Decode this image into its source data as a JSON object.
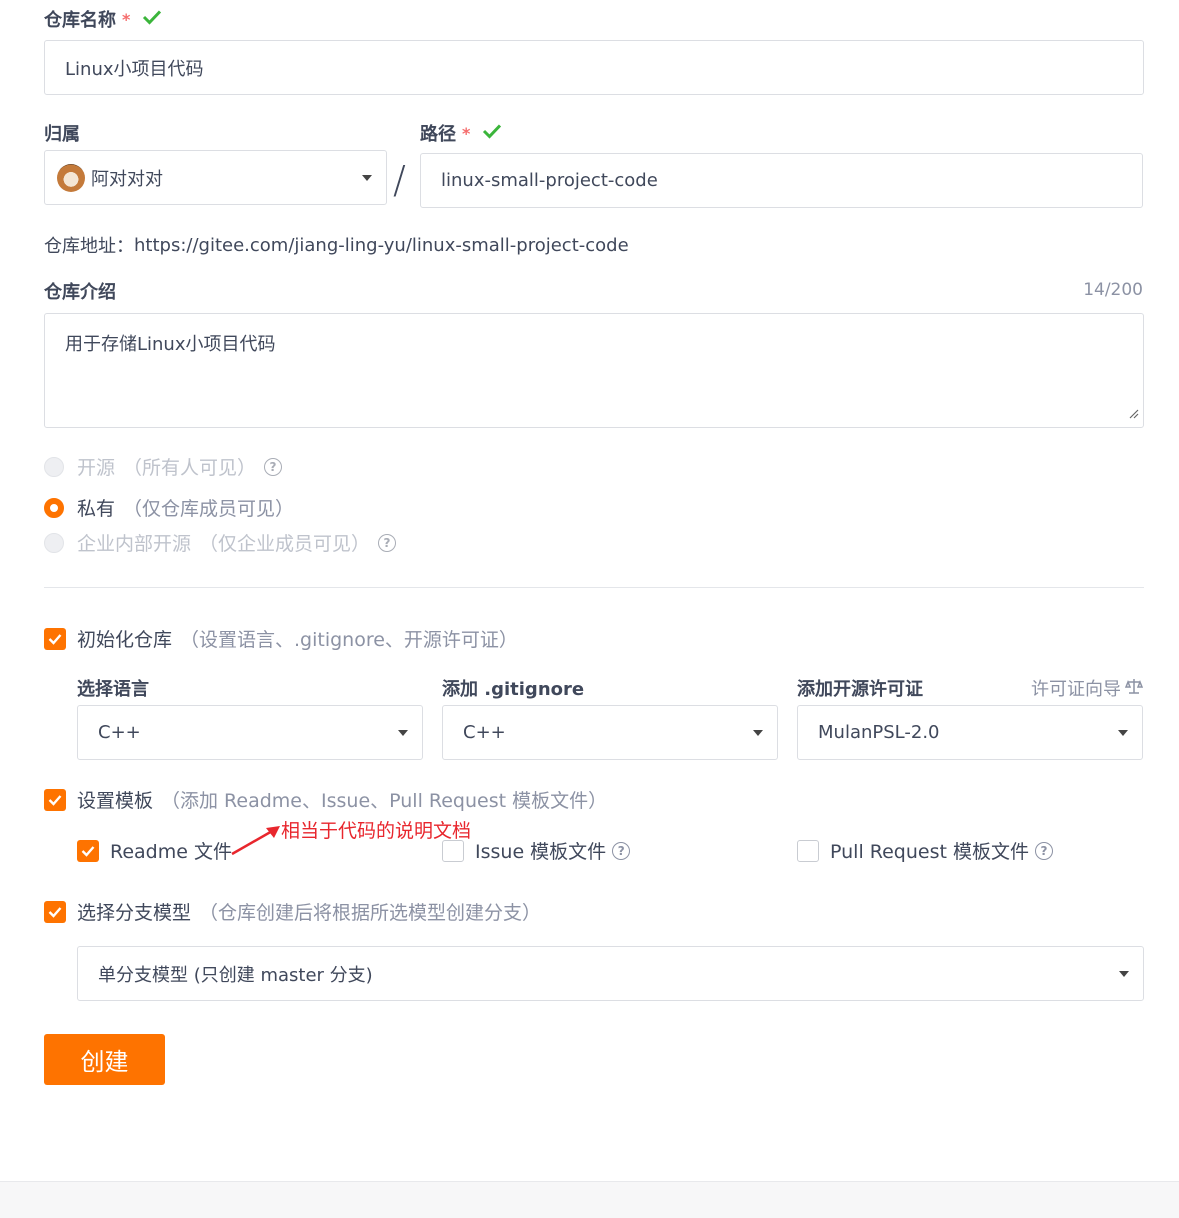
{
  "repo_name": {
    "label": "仓库名称",
    "required": "*",
    "value": "Linux小项目代码"
  },
  "owner": {
    "label": "归属",
    "value": "阿对对对"
  },
  "path": {
    "label": "路径",
    "required": "*",
    "value": "linux-small-project-code"
  },
  "separator": "/",
  "repo_address": {
    "label": "仓库地址：",
    "url": "https://gitee.com/jiang-ling-yu/linux-small-project-code"
  },
  "intro": {
    "label": "仓库介绍",
    "count": "14/200",
    "value": "用于存储Linux小项目代码"
  },
  "visibility": {
    "options": [
      {
        "label": "开源",
        "hint": "（所有人可见）",
        "selected": false,
        "disabled": true,
        "help": "?"
      },
      {
        "label": "私有",
        "hint": "（仅仓库成员可见）",
        "selected": true,
        "disabled": false
      },
      {
        "label": "企业内部开源",
        "hint": "（仅企业成员可见）",
        "selected": false,
        "disabled": true,
        "help": "?"
      }
    ]
  },
  "init_repo": {
    "label": "初始化仓库",
    "hint": "（设置语言、.gitignore、开源许可证）",
    "checked": true,
    "language": {
      "label": "选择语言",
      "value": "C++"
    },
    "gitignore": {
      "label": "添加 .gitignore",
      "value": "C++"
    },
    "license": {
      "label": "添加开源许可证",
      "wizard": "许可证向导",
      "value": "MulanPSL-2.0"
    }
  },
  "template": {
    "label": "设置模板",
    "hint": "（添加 Readme、Issue、Pull Request 模板文件）",
    "checked": true,
    "readme": {
      "label": "Readme 文件",
      "checked": true
    },
    "issue": {
      "label": "Issue 模板文件",
      "checked": false
    },
    "pr": {
      "label": "Pull Request 模板文件",
      "checked": false
    },
    "annotation": "相当于代码的说明文档"
  },
  "branch": {
    "label": "选择分支模型",
    "hint": "（仓库创建后将根据所选模型创建分支）",
    "checked": true,
    "value": "单分支模型 (只创建 master 分支)"
  },
  "create_button": "创建",
  "colors": {
    "accent": "#fe7300",
    "success": "#3bb53b",
    "annotation": "#e8262d"
  }
}
